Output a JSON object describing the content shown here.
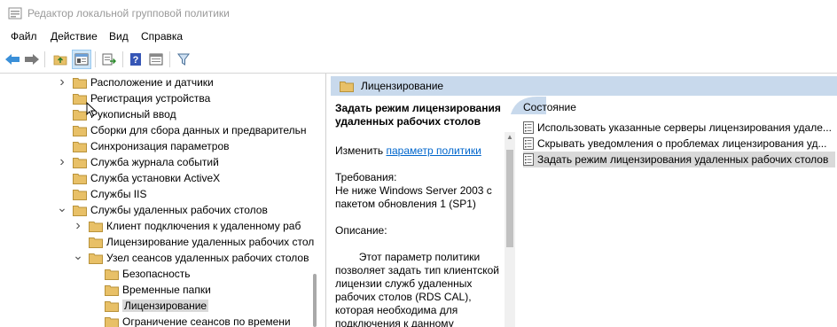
{
  "window": {
    "title": "Редактор локальной групповой политики"
  },
  "menu": [
    {
      "label": "Файл"
    },
    {
      "label": "Действие"
    },
    {
      "label": "Вид"
    },
    {
      "label": "Справка"
    }
  ],
  "toolbar": {
    "buttons": [
      {
        "icon": "back-arrow-icon"
      },
      {
        "icon": "forward-arrow-icon"
      },
      {
        "icon": "up-folder-icon"
      },
      {
        "icon": "show-hide-tree-icon"
      },
      {
        "icon": "export-list-icon"
      },
      {
        "icon": "help-icon"
      },
      {
        "icon": "properties-icon"
      },
      {
        "icon": "filter-icon"
      }
    ]
  },
  "tree": {
    "items": [
      {
        "label": "Расположение и датчики",
        "level": 0,
        "chevron": "right"
      },
      {
        "label": "Регистрация устройства",
        "level": 0,
        "chevron": ""
      },
      {
        "label": "Рукописный ввод",
        "level": 0,
        "chevron": ""
      },
      {
        "label": "Сборки для сбора данных и предварительн",
        "level": 0,
        "chevron": ""
      },
      {
        "label": "Синхронизация параметров",
        "level": 0,
        "chevron": ""
      },
      {
        "label": "Служба журнала событий",
        "level": 0,
        "chevron": "right"
      },
      {
        "label": "Служба установки ActiveX",
        "level": 0,
        "chevron": ""
      },
      {
        "label": "Службы IIS",
        "level": 0,
        "chevron": ""
      },
      {
        "label": "Службы удаленных рабочих столов",
        "level": 0,
        "chevron": "down"
      },
      {
        "label": "Клиент подключения к удаленному раб",
        "level": 1,
        "chevron": "right"
      },
      {
        "label": "Лицензирование удаленных рабочих стол",
        "level": 1,
        "chevron": ""
      },
      {
        "label": "Узел сеансов удаленных рабочих столов",
        "level": 1,
        "chevron": "down"
      },
      {
        "label": "Безопасность",
        "level": 2,
        "chevron": ""
      },
      {
        "label": "Временные папки",
        "level": 2,
        "chevron": ""
      },
      {
        "label": "Лицензирование",
        "level": 2,
        "chevron": "",
        "selected": true
      },
      {
        "label": "Ограничение сеансов по времени",
        "level": 2,
        "chevron": ""
      }
    ]
  },
  "details": {
    "header": "Лицензирование",
    "policy_title": "Задать режим лицензирования удаленных рабочих столов",
    "edit_prefix": "Изменить",
    "edit_link": "параметр политики",
    "requirements_label": "Требования:",
    "requirements_line1": "Не ниже Windows Server 2003 с",
    "requirements_line2": "пакетом обновления 1 (SP1)",
    "description_label": "Описание:",
    "description_lines": [
      "Этот параметр политики",
      "позволяет задать тип клиентской",
      "лицензии служб удаленных",
      "рабочих столов (RDS CAL),",
      "которая необходима для",
      "подключения к данному"
    ]
  },
  "list": {
    "column_header": "Состояние",
    "items": [
      {
        "label": "Использовать указанные серверы лицензирования удале..."
      },
      {
        "label": "Скрывать уведомления о проблемах лицензирования уд..."
      },
      {
        "label": "Задать режим лицензирования удаленных рабочих столов",
        "selected": true
      }
    ]
  },
  "colors": {
    "header_bg": "#c8d9ec",
    "selection_bg": "#d9d9d9",
    "link": "#0066cc",
    "folder": "#e8c067"
  }
}
